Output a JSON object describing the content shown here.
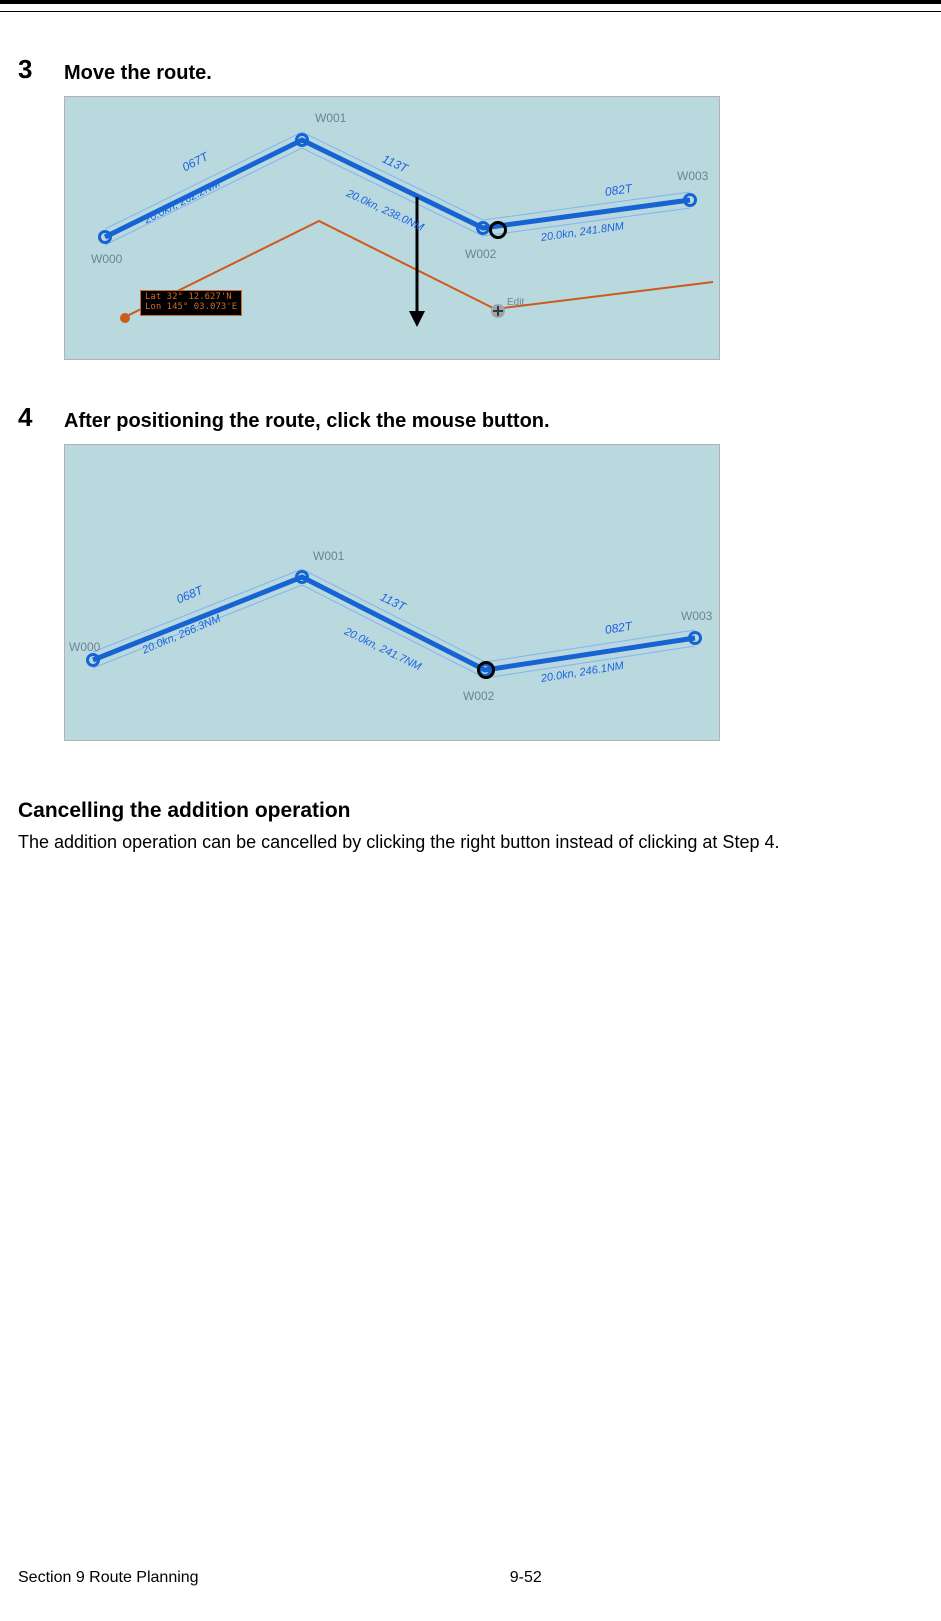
{
  "steps": {
    "a": {
      "num": "3",
      "title": "Move the route."
    },
    "b": {
      "num": "4",
      "title": "After positioning the route, click the mouse button."
    }
  },
  "fig1": {
    "waypoints": {
      "w0": "W000",
      "w1": "W001",
      "w2": "W002",
      "w3": "W003"
    },
    "legs": {
      "l01": {
        "t": "067T",
        "sd": "20.0kn, 262.2NM"
      },
      "l12": {
        "t": "113T",
        "sd": "20.0kn, 238.0NM"
      },
      "l23": {
        "t": "082T",
        "sd": "20.0kn, 241.8NM"
      }
    },
    "edit_label": "Edit",
    "info": {
      "line1": "Lat  32° 12.627'N",
      "line2": "Lon 145° 03.073'E"
    }
  },
  "fig2": {
    "waypoints": {
      "w0": "W000",
      "w1": "W001",
      "w2": "W002",
      "w3": "W003"
    },
    "legs": {
      "l01": {
        "t": "068T",
        "sd": "20.0kn, 266.3NM"
      },
      "l12": {
        "t": "113T",
        "sd": "20.0kn, 241.7NM"
      },
      "l23": {
        "t": "082T",
        "sd": "20.0kn, 246.1NM"
      }
    }
  },
  "section": {
    "heading": "Cancelling the addition operation",
    "text": "The addition operation can be cancelled by clicking the right button instead of clicking at Step 4."
  },
  "footer": {
    "section": "Section 9    Route Planning",
    "page": "9-52"
  }
}
